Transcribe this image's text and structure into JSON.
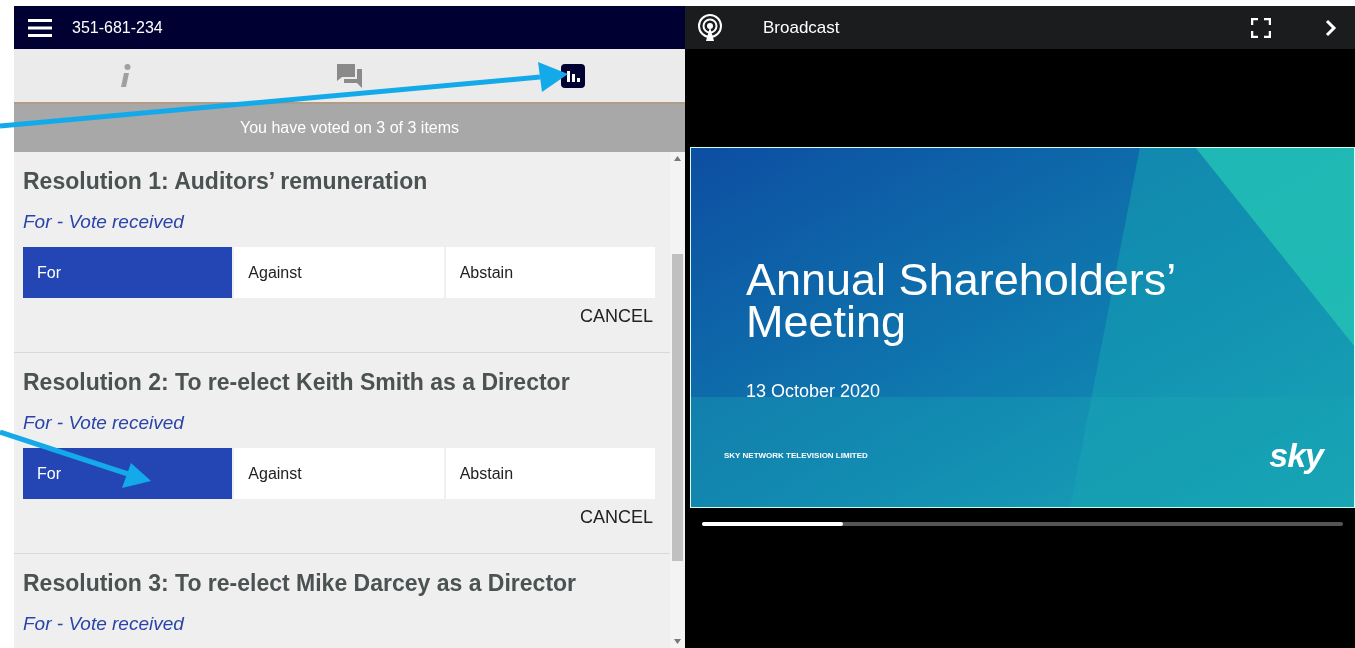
{
  "header": {
    "meeting_id": "351-681-234"
  },
  "tabs": [
    {
      "kind": "info",
      "selected": false
    },
    {
      "kind": "chat",
      "selected": false
    },
    {
      "kind": "results",
      "selected": true
    }
  ],
  "vote_summary": "You have voted on 3 of 3 items",
  "resolutions": [
    {
      "title": "Resolution 1: Auditors’ remuneration",
      "status": "For - Vote received",
      "options": [
        {
          "label": "For",
          "selected": true
        },
        {
          "label": "Against",
          "selected": false
        },
        {
          "label": "Abstain",
          "selected": false
        }
      ],
      "cancel": "CANCEL"
    },
    {
      "title": "Resolution 2: To re-elect Keith Smith as a Director",
      "status": "For - Vote received",
      "options": [
        {
          "label": "For",
          "selected": true
        },
        {
          "label": "Against",
          "selected": false
        },
        {
          "label": "Abstain",
          "selected": false
        }
      ],
      "cancel": "CANCEL"
    },
    {
      "title": "Resolution 3: To re-elect Mike Darcey as a Director",
      "status": "For - Vote received"
    }
  ],
  "broadcast": {
    "title": "Broadcast",
    "slide": {
      "title_lines": [
        "Annual Shareholders’",
        "Meeting"
      ],
      "date": "13 October 2020",
      "company": "SKY NETWORK TELEVISION LIMITED",
      "logo": "sky"
    },
    "progress": {
      "level": 0.22
    }
  },
  "annotations": [
    {
      "kind": "arrow"
    },
    {
      "kind": "arrow"
    }
  ]
}
